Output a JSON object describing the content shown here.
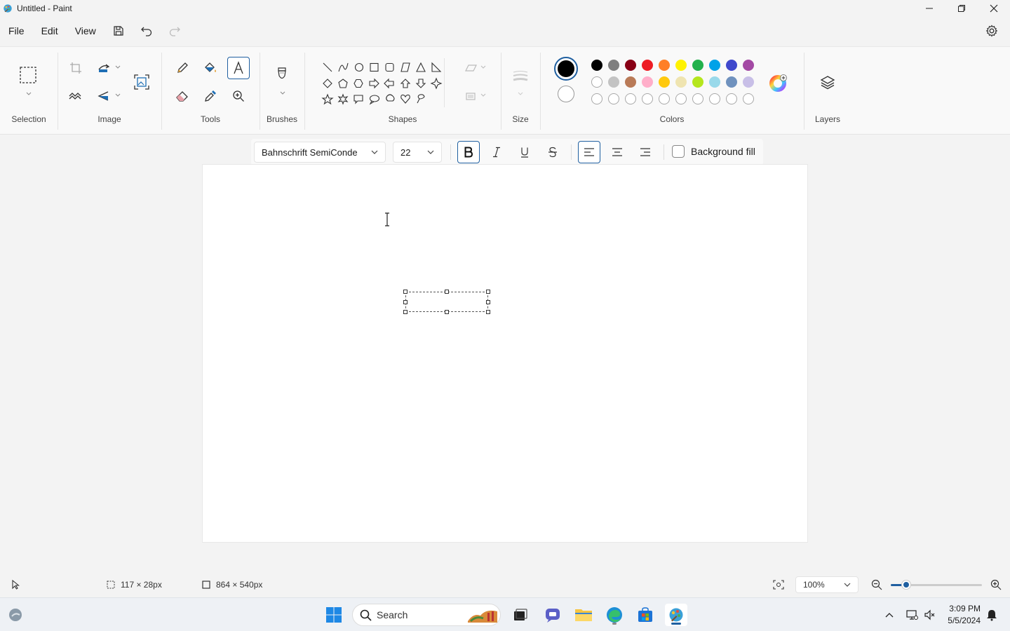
{
  "window": {
    "title": "Untitled - Paint",
    "controls": [
      "minimize-icon",
      "maximize-icon",
      "close-icon"
    ]
  },
  "menu": {
    "items": [
      "File",
      "Edit",
      "View"
    ],
    "quick_access": [
      "save-icon",
      "undo-icon",
      "redo-icon"
    ]
  },
  "ribbon": {
    "groups": {
      "selection": "Selection",
      "image": "Image",
      "tools": "Tools",
      "brushes": "Brushes",
      "shapes": "Shapes",
      "size": "Size",
      "colors": "Colors",
      "layers": "Layers"
    },
    "active_tool": "text",
    "primary_color": "#000000",
    "secondary_color": "#ffffff",
    "palette_row1": [
      "#000000",
      "#7f7f7f",
      "#880015",
      "#ed1c24",
      "#ff7f27",
      "#fff200",
      "#22b14c",
      "#00a2e8",
      "#3f48cc",
      "#a349a4"
    ],
    "palette_row2": [
      "#ffffff",
      "#c3c3c3",
      "#b97a57",
      "#ffaec9",
      "#ffc90e",
      "#efe4b0",
      "#b5e61d",
      "#99d9ea",
      "#7092be",
      "#c8bfe7"
    ],
    "palette_row3_empty_count": 10
  },
  "text_toolbar": {
    "font": "Bahnschrift SemiConde",
    "size": "22",
    "bold": true,
    "italic": false,
    "underline": false,
    "strikethrough": false,
    "alignment": "left",
    "background_fill_label": "Background fill",
    "background_fill_checked": false
  },
  "status": {
    "selection_size": "117 × 28px",
    "canvas_size": "864 × 540px",
    "zoom": "100%",
    "zoom_fraction": 0.17
  },
  "taskbar": {
    "search_placeholder": "Search",
    "time": "3:09 PM",
    "date": "5/5/2024"
  }
}
